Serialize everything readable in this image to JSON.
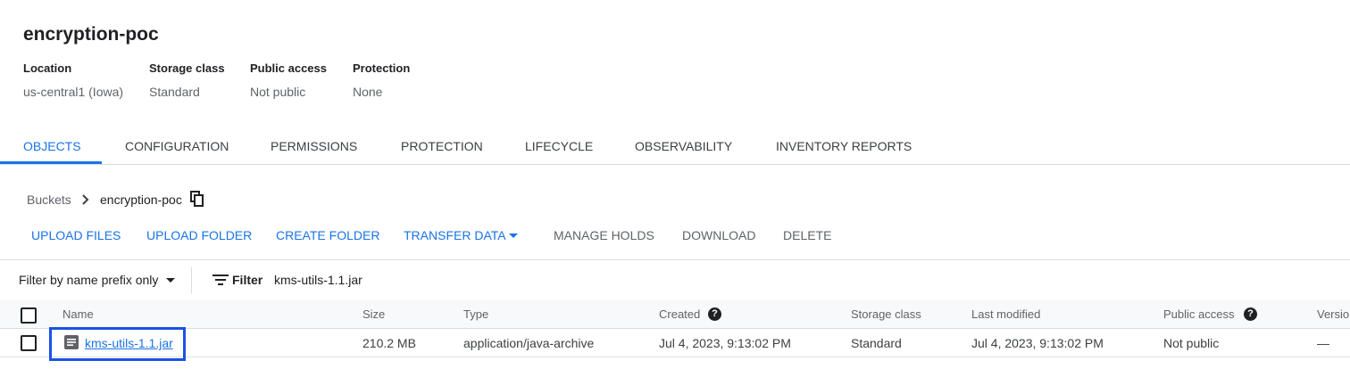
{
  "bucket": {
    "title": "encryption-poc",
    "meta": [
      {
        "label": "Location",
        "value": "us-central1 (Iowa)"
      },
      {
        "label": "Storage class",
        "value": "Standard"
      },
      {
        "label": "Public access",
        "value": "Not public"
      },
      {
        "label": "Protection",
        "value": "None"
      }
    ]
  },
  "tabs": [
    {
      "label": "OBJECTS",
      "active": true
    },
    {
      "label": "CONFIGURATION"
    },
    {
      "label": "PERMISSIONS"
    },
    {
      "label": "PROTECTION"
    },
    {
      "label": "LIFECYCLE"
    },
    {
      "label": "OBSERVABILITY"
    },
    {
      "label": "INVENTORY REPORTS"
    }
  ],
  "breadcrumb": {
    "root": "Buckets",
    "current": "encryption-poc"
  },
  "actions": {
    "upload_files": "UPLOAD FILES",
    "upload_folder": "UPLOAD FOLDER",
    "create_folder": "CREATE FOLDER",
    "transfer_data": "TRANSFER DATA",
    "manage_holds": "MANAGE HOLDS",
    "download": "DOWNLOAD",
    "delete": "DELETE"
  },
  "filter": {
    "mode": "Filter by name prefix only",
    "label": "Filter",
    "value": "kms-utils-1.1.jar"
  },
  "table": {
    "columns": {
      "name": "Name",
      "size": "Size",
      "type": "Type",
      "created": "Created",
      "storage_class": "Storage class",
      "last_modified": "Last modified",
      "public_access": "Public access",
      "version": "Versio"
    },
    "help_glyph": "?",
    "rows": [
      {
        "name": "kms-utils-1.1.jar",
        "size": "210.2 MB",
        "type": "application/java-archive",
        "created": "Jul 4, 2023, 9:13:02 PM",
        "storage_class": "Standard",
        "last_modified": "Jul 4, 2023, 9:13:02 PM",
        "public_access": "Not public",
        "version": "—",
        "icon": "file-document-icon"
      }
    ]
  },
  "colors": {
    "accent": "#1a73e8",
    "highlight": "#1a52e6"
  }
}
